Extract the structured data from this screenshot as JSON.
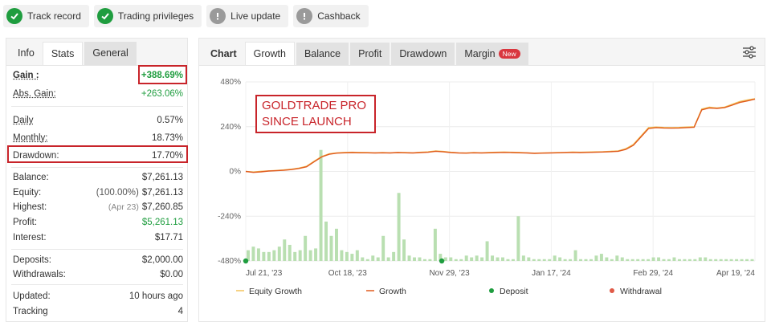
{
  "badges": [
    {
      "label": "Track record",
      "status": "check"
    },
    {
      "label": "Trading privileges",
      "status": "check"
    },
    {
      "label": "Live update",
      "status": "info"
    },
    {
      "label": "Cashback",
      "status": "info"
    }
  ],
  "stats_tabs": [
    "Info",
    "Stats",
    "General"
  ],
  "stats": {
    "gain": {
      "label": "Gain :",
      "value": "+388.69%"
    },
    "abs_gain": {
      "label": "Abs. Gain:",
      "value": "+263.06%"
    },
    "daily": {
      "label": "Daily",
      "value": "0.57%"
    },
    "monthly": {
      "label": "Monthly:",
      "value": "18.73%"
    },
    "drawdown": {
      "label": "Drawdown:",
      "value": "17.70%"
    },
    "balance": {
      "label": "Balance:",
      "value": "$7,261.13"
    },
    "equity": {
      "label": "Equity:",
      "paren": "(100.00%)",
      "value": "$7,261.13"
    },
    "highest": {
      "label": "Highest:",
      "date": "(Apr 23)",
      "value": "$7,260.85"
    },
    "profit": {
      "label": "Profit:",
      "value": "$5,261.13"
    },
    "interest": {
      "label": "Interest:",
      "value": "$17.71"
    },
    "deposits": {
      "label": "Deposits:",
      "value": "$2,000.00"
    },
    "withdrawals": {
      "label": "Withdrawals:",
      "value": "$0.00"
    },
    "updated": {
      "label": "Updated:",
      "value": "10 hours ago"
    },
    "tracking": {
      "label": "Tracking",
      "value": "4"
    }
  },
  "chart_tabs": {
    "chart": "Chart",
    "growth": "Growth",
    "balance": "Balance",
    "profit": "Profit",
    "drawdown": "Drawdown",
    "margin": "Margin",
    "margin_badge": "New"
  },
  "annotation": {
    "line1": "GOLDTRADE PRO",
    "line2": "SINCE LAUNCH"
  },
  "colors": {
    "growth": "#e05a1e",
    "equity": "#f3c35a",
    "bars": "#b9dfb1",
    "deposit": "#1f9d3f",
    "withdrawal": "#e05a47",
    "highlight": "#c8242a"
  },
  "chart_data": {
    "type": "line",
    "y_ticks": [
      "480%",
      "240%",
      "0%",
      "-240%",
      "-480%"
    ],
    "ylim": [
      -480,
      480
    ],
    "x_ticks": [
      "Jul 21, '23",
      "Oct 18, '23",
      "Nov 29, '23",
      "Jan 17, '24",
      "Feb 29, '24",
      "Apr 19, '24"
    ],
    "series": [
      {
        "name": "Equity Growth",
        "values": [
          0,
          -3,
          1,
          3,
          5,
          8,
          12,
          18,
          28,
          55,
          80,
          95,
          100,
          102,
          103,
          102,
          101,
          100,
          101,
          100,
          102,
          101,
          100,
          103,
          105,
          110,
          107,
          103,
          100,
          99,
          101,
          100,
          102,
          103,
          104,
          103,
          102,
          100,
          98,
          99,
          100,
          101,
          102,
          104,
          103,
          104,
          105,
          106,
          108,
          110,
          122,
          145,
          190,
          235,
          238,
          236,
          235,
          236,
          238,
          240,
          335,
          345,
          340,
          345,
          360,
          375,
          383,
          390
        ]
      },
      {
        "name": "Growth",
        "values": [
          0,
          -5,
          -2,
          2,
          4,
          6,
          10,
          16,
          25,
          52,
          78,
          92,
          98,
          100,
          101,
          100,
          100,
          99,
          100,
          99,
          101,
          100,
          99,
          101,
          103,
          108,
          105,
          101,
          99,
          98,
          100,
          99,
          100,
          101,
          102,
          101,
          100,
          99,
          97,
          98,
          99,
          100,
          101,
          102,
          101,
          102,
          103,
          104,
          106,
          108,
          118,
          140,
          185,
          230,
          235,
          233,
          232,
          233,
          235,
          237,
          330,
          340,
          338,
          342,
          355,
          370,
          378,
          388
        ]
      }
    ],
    "bars": [
      6,
      8,
      7,
      5,
      5,
      6,
      8,
      12,
      9,
      5,
      6,
      14,
      6,
      7,
      62,
      22,
      14,
      18,
      6,
      5,
      4,
      6,
      2,
      1,
      3,
      2,
      14,
      2,
      5,
      38,
      12,
      3,
      2,
      2,
      1,
      1,
      18,
      4,
      2,
      2,
      1,
      1,
      3,
      2,
      3,
      2,
      11,
      3,
      2,
      2,
      1,
      1,
      25,
      3,
      2,
      1,
      1,
      1,
      1,
      3,
      2,
      1,
      1,
      6,
      1,
      1,
      1,
      3,
      4,
      2,
      1,
      3,
      2,
      1,
      1,
      1,
      1,
      1,
      2,
      2,
      1,
      1,
      2,
      1,
      1,
      1,
      1,
      2,
      2,
      1,
      1,
      1,
      1,
      1,
      1,
      1,
      1,
      1
    ],
    "legend": [
      {
        "label": "Equity Growth",
        "kind": "line"
      },
      {
        "label": "Growth",
        "kind": "line"
      },
      {
        "label": "Deposit",
        "kind": "dot"
      },
      {
        "label": "Withdrawal",
        "kind": "dot"
      }
    ]
  }
}
